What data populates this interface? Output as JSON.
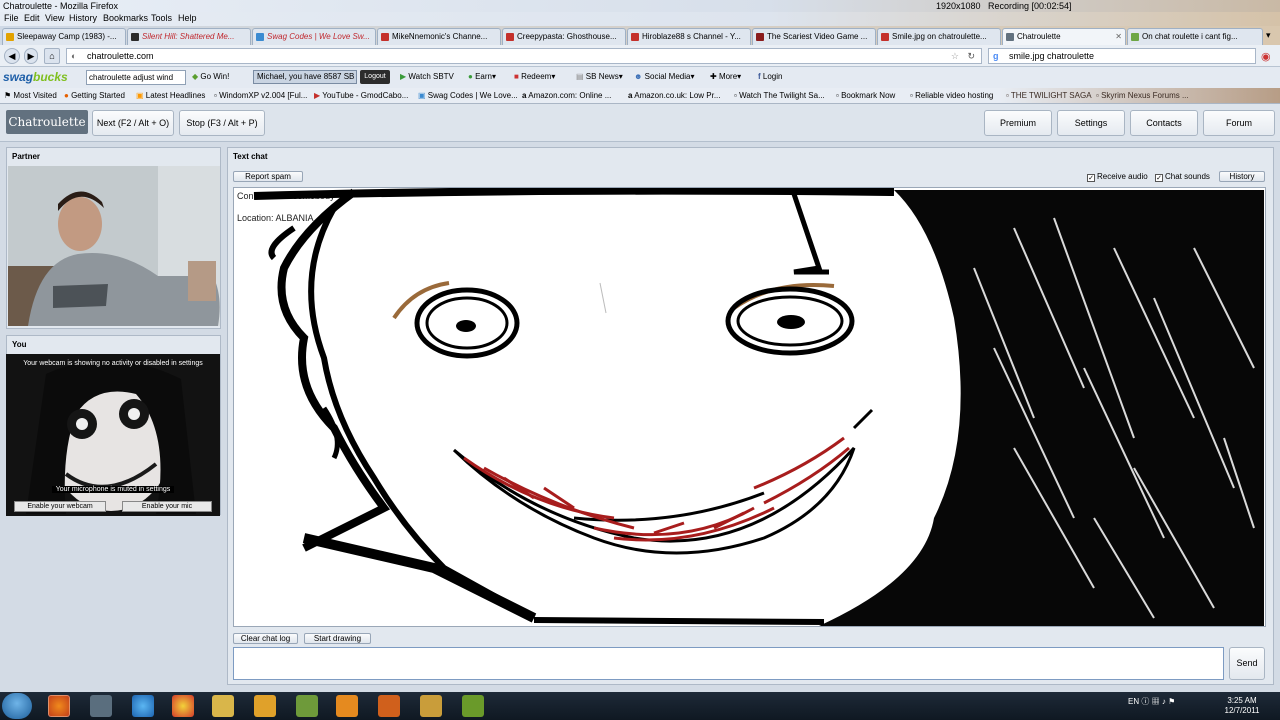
{
  "window": {
    "title": "Chatroulette - Mozilla Firefox",
    "resolution": "1920x1080",
    "recording": "Recording [00:02:54]"
  },
  "menu": [
    "File",
    "Edit",
    "View",
    "History",
    "Bookmarks",
    "Tools",
    "Help"
  ],
  "tabs": [
    {
      "label": "Sleepaway Camp (1983) -...",
      "color": "#e2a200"
    },
    {
      "label": "Silent Hill: Shattered Me...",
      "color": "#2b2b2b"
    },
    {
      "label": "Swag Codes | We Love Sw...",
      "color": "#3b8bd1"
    },
    {
      "label": "MikeNnemonic's Channe...",
      "color": "#c4302b"
    },
    {
      "label": "Creepypasta: Ghosthouse...",
      "color": "#c4302b"
    },
    {
      "label": "Hiroblaze88 s Channel - Y...",
      "color": "#c4302b"
    },
    {
      "label": "The Scariest Video Game ...",
      "color": "#8a1c1c"
    },
    {
      "label": "Smile.jpg on chatroulette...",
      "color": "#c4302b"
    },
    {
      "label": "Chatroulette",
      "color": "#62717f"
    },
    {
      "label": "On chat roulette i cant fig...",
      "color": "#6da644"
    }
  ],
  "nav": {
    "url": "chatroulette.com",
    "search": "smile.jpg chatroulette"
  },
  "swagbucks": {
    "logo_a": "swag",
    "logo_b": "bucks",
    "search_value": "chatroulette adjust wind",
    "go": "Go Win!",
    "message": "Michael, you have 8587 SB",
    "logout": "Logout",
    "items": [
      "Watch SBTV",
      "Earn",
      "Redeem",
      "SB News",
      "Social Media",
      "More",
      "Login"
    ]
  },
  "bookmarks": [
    "Most Visited",
    "Getting Started",
    "Latest Headlines",
    "WindomXP v2.004 [Ful...",
    "YouTube - GmodCabo...",
    "Swag Codes | We Love...",
    "Amazon.com: Online ...",
    "Amazon.co.uk: Low Pr...",
    "Watch The Twilight Sa...",
    "Bookmark Now",
    "Reliable video hosting",
    "THE TWILIGHT SAGA",
    "Skyrim Nexus Forums ..."
  ],
  "header": {
    "brand": "Chatroulette",
    "next": "Next (F2 / Alt + O)",
    "stop": "Stop (F3 / Alt + P)",
    "premium": "Premium",
    "settings": "Settings",
    "contacts": "Contacts",
    "forum": "Forum"
  },
  "partner": {
    "title": "Partner"
  },
  "you": {
    "title": "You",
    "webcam_msg": "Your webcam is showing no activity or disabled in settings",
    "mic_msg": "Your microphone is muted in settings",
    "enable_webcam": "Enable your webcam",
    "enable_mic": "Enable your mic"
  },
  "chat": {
    "title": "Text chat",
    "report": "Report spam",
    "receive_audio": "Receive audio",
    "chat_sounds": "Chat sounds",
    "history": "History",
    "line1": "Connected to somebody",
    "line2": "Location: ALBANIA",
    "clear": "Clear chat log",
    "draw": "Start drawing",
    "send": "Send"
  },
  "taskbar": {
    "lang": "EN",
    "time": "3:25 AM",
    "date": "12/7/2011"
  }
}
